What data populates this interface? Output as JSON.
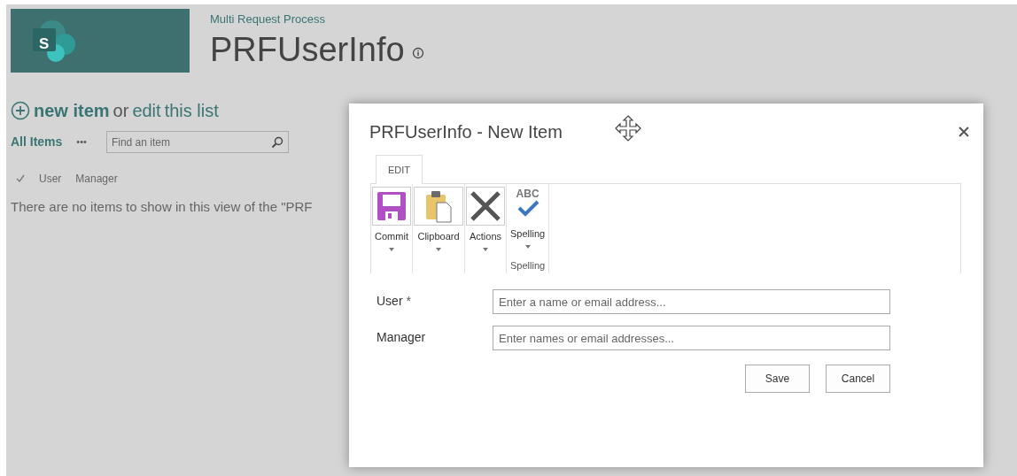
{
  "site": {
    "logo_letter": "S",
    "site_name": "Multi Request Process",
    "title": "PRFUserInfo"
  },
  "command": {
    "new_item": "new item",
    "connector": "or",
    "edit": "edit",
    "rest": "this list"
  },
  "views": {
    "current": "All Items",
    "more": "•••",
    "search": {
      "placeholder": "Find an item"
    }
  },
  "columns": [
    "User",
    "Manager"
  ],
  "empty_message": "There are no items to show in this view of the \"PRF",
  "dialog": {
    "title": "PRFUserInfo - New Item",
    "tabs": [
      {
        "label": "EDIT",
        "selected": true
      }
    ],
    "ribbon_groups": [
      {
        "buttons": [
          {
            "label": "Commit",
            "kind": "save"
          }
        ]
      },
      {
        "buttons": [
          {
            "label": "Clipboard",
            "kind": "clipboard"
          }
        ]
      },
      {
        "buttons": [
          {
            "label": "Actions",
            "kind": "delete"
          }
        ]
      },
      {
        "label": "Spelling",
        "buttons": [
          {
            "label": "Spelling",
            "kind": "spelling",
            "icon_text": "ABC"
          }
        ]
      }
    ],
    "required_mark": "*",
    "fields": [
      {
        "label": "User",
        "required": true,
        "placeholder": "Enter a name or email address..."
      },
      {
        "label": "Manager",
        "required": false,
        "placeholder": "Enter names or email addresses..."
      }
    ],
    "buttons": [
      "Save",
      "Cancel"
    ]
  }
}
